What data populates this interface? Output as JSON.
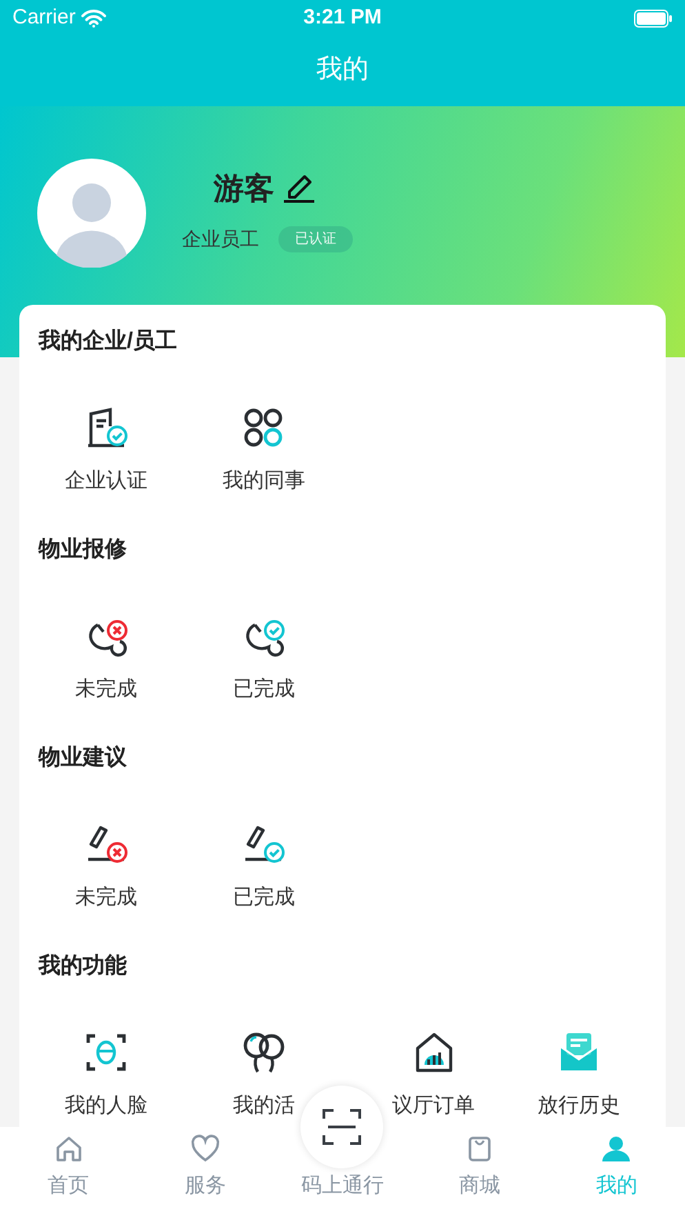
{
  "status_bar": {
    "carrier": "Carrier",
    "time": "3:21 PM"
  },
  "nav_bar": {
    "title": "我的"
  },
  "profile": {
    "name": "游客",
    "role": "企业员工",
    "badge": "已认证"
  },
  "sections": [
    {
      "title": "我的企业/员工",
      "items": [
        {
          "label": "企业认证"
        },
        {
          "label": "我的同事"
        }
      ]
    },
    {
      "title": "物业报修",
      "items": [
        {
          "label": "未完成"
        },
        {
          "label": "已完成"
        }
      ]
    },
    {
      "title": "物业建议",
      "items": [
        {
          "label": "未完成"
        },
        {
          "label": "已完成"
        }
      ]
    },
    {
      "title": "我的功能",
      "items": [
        {
          "label": "我的人脸"
        },
        {
          "label": "我的活"
        },
        {
          "label": "议厅订单"
        },
        {
          "label": "放行历史"
        }
      ]
    }
  ],
  "tab_bar": [
    {
      "label": "首页",
      "kind": "tab",
      "selected": false
    },
    {
      "label": "服务",
      "kind": "tab",
      "selected": false
    },
    {
      "label": "码上通行",
      "kind": "scan",
      "selected": false
    },
    {
      "label": "商城",
      "kind": "tab",
      "selected": false
    },
    {
      "label": "我的",
      "kind": "tab",
      "selected": true
    }
  ]
}
